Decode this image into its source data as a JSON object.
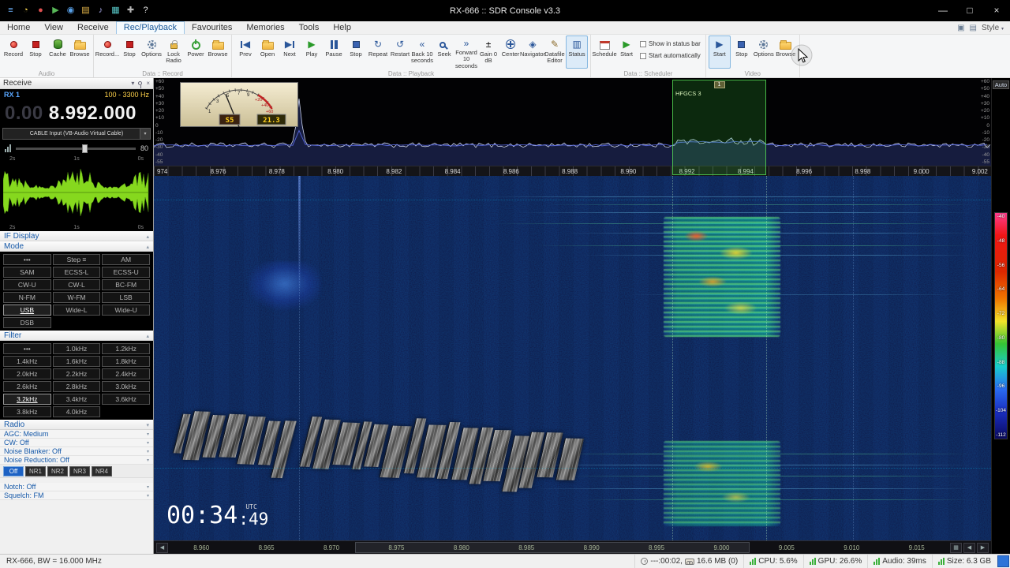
{
  "window": {
    "title": "RX-666 :: SDR Console v3.3",
    "minimize": "—",
    "maximize": "□",
    "close": "×",
    "quick_access": [
      {
        "name": "app-menu-icon",
        "glyph": "≡",
        "color": "#6fb4ff"
      },
      {
        "name": "clock-icon",
        "glyph": "◔",
        "color": "#e8c84a"
      },
      {
        "name": "record-icon",
        "glyph": "●",
        "color": "#e05050"
      },
      {
        "name": "play-icon",
        "glyph": "▶",
        "color": "#58b858"
      },
      {
        "name": "globe-icon",
        "glyph": "◉",
        "color": "#58a0e8"
      },
      {
        "name": "folder-icon",
        "glyph": "▤",
        "color": "#e8b84a"
      },
      {
        "name": "audio-icon",
        "glyph": "♪",
        "color": "#a8a8e8"
      },
      {
        "name": "grid-icon",
        "glyph": "▦",
        "color": "#58c8c8"
      },
      {
        "name": "tools-icon",
        "glyph": "✚",
        "color": "#b8b8b8"
      },
      {
        "name": "help-icon",
        "glyph": "?",
        "color": "#e8e8e8"
      }
    ]
  },
  "menubar": {
    "items": [
      {
        "label": "Home"
      },
      {
        "label": "View"
      },
      {
        "label": "Receive"
      },
      {
        "label": "Rec/Playback",
        "selected": true
      },
      {
        "label": "Favourites"
      },
      {
        "label": "Memories"
      },
      {
        "label": "Tools"
      },
      {
        "label": "Help"
      }
    ],
    "style_label": "Style"
  },
  "icons": {
    "chev_down": "▾",
    "chev_up": "▴",
    "prev": "◀",
    "next": "▶",
    "play": "▶",
    "repeat": "↻",
    "restart": "↺",
    "back10": "«",
    "fwd10": "»",
    "gain": "±",
    "navigator": "◈",
    "pencil": "✎",
    "status": "▥",
    "close": "×"
  },
  "ribbon": {
    "audio": {
      "title": "Audio",
      "record": "Record",
      "stop": "Stop",
      "cache": "Cache",
      "browse": "Browse"
    },
    "data_record": {
      "title": "Data :: Record",
      "record": "Record...",
      "stop": "Stop",
      "options": "Options",
      "lock": "Lock\nRadio",
      "power": "Power",
      "browse": "Browse"
    },
    "data_playback": {
      "title": "Data :: Playback",
      "prev": "Prev",
      "open": "Open",
      "next": "Next",
      "play": "Play",
      "pause": "Pause",
      "stop": "Stop",
      "repeat": "Repeat",
      "restart": "Restart",
      "back10": "Back 10\nseconds",
      "seek": "Seek",
      "fwd10": "Forward 10\nseconds",
      "gain": "Gain 0\ndB",
      "center": "Center",
      "navigator": "Navigator",
      "datafile": "Datafile\nEditor",
      "status": "Status"
    },
    "data_scheduler": {
      "title": "Data :: Scheduler",
      "schedule": "Schedule",
      "start": "Start",
      "checkbox_status": "Show in status bar",
      "checkbox_auto": "Start automatically"
    },
    "video": {
      "title": "Video",
      "start": "Start",
      "stop": "Stop",
      "options": "Options",
      "browse": "Browse"
    }
  },
  "receive": {
    "panel_title": "Receive",
    "rx_label": "RX 1",
    "range": "100 - 3300 Hz",
    "freq_dim": "0.00",
    "freq_main": "8.992.000",
    "audio_device": "CABLE Input (VB-Audio Virtual Cable)",
    "volume": "80",
    "wave_times": [
      "2s",
      "1s",
      "0s"
    ],
    "if_display_header": "IF Display",
    "mode_header": "Mode",
    "modes": [
      {
        "label": "•••"
      },
      {
        "label": "Step ≡"
      },
      {
        "label": "AM"
      },
      {
        "label": "SAM"
      },
      {
        "label": "ECSS-L"
      },
      {
        "label": "ECSS-U"
      },
      {
        "label": "CW-U"
      },
      {
        "label": "CW-L"
      },
      {
        "label": "BC-FM"
      },
      {
        "label": "N-FM"
      },
      {
        "label": "W-FM"
      },
      {
        "label": "LSB"
      },
      {
        "label": "USB",
        "selected": true
      },
      {
        "label": "Wide-L"
      },
      {
        "label": "Wide-U"
      },
      {
        "label": "DSB"
      }
    ],
    "filter_header": "Filter",
    "filters": [
      {
        "label": "•••"
      },
      {
        "label": "1.0kHz"
      },
      {
        "label": "1.2kHz"
      },
      {
        "label": "1.4kHz"
      },
      {
        "label": "1.6kHz"
      },
      {
        "label": "1.8kHz"
      },
      {
        "label": "2.0kHz"
      },
      {
        "label": "2.2kHz"
      },
      {
        "label": "2.4kHz"
      },
      {
        "label": "2.6kHz"
      },
      {
        "label": "2.8kHz"
      },
      {
        "label": "3.0kHz"
      },
      {
        "label": "3.2kHz",
        "selected": true
      },
      {
        "label": "3.4kHz"
      },
      {
        "label": "3.6kHz"
      },
      {
        "label": "3.8kHz"
      },
      {
        "label": "4.0kHz"
      }
    ],
    "radio_header": "Radio",
    "agc": "AGC: Medium",
    "cw": "CW: Off",
    "noise_blanker": "Noise Blanker: Off",
    "noise_reduction": "Noise Reduction: Off",
    "nr_buttons": [
      {
        "label": "Off",
        "selected": true
      },
      {
        "label": "NR1"
      },
      {
        "label": "NR2"
      },
      {
        "label": "NR3"
      },
      {
        "label": "NR4"
      }
    ],
    "notch": "Notch: Off",
    "squelch": "Squelch: FM"
  },
  "smeter": {
    "scale": [
      "1",
      "3",
      "5",
      "7",
      "9",
      "+20",
      "+40",
      "+60"
    ],
    "s_value": "S5",
    "db_value": "21.3"
  },
  "spectrum": {
    "db_labels": [
      "+60",
      "+50",
      "+40",
      "+30",
      "+20",
      "+10",
      "0",
      "-10",
      "-20",
      "-30",
      "-40",
      "-55"
    ],
    "selection": {
      "label": "HFGCS 3",
      "badge": "1"
    },
    "scale_labels": [
      "974",
      "8.976",
      "8.978",
      "8.980",
      "8.982",
      "8.984",
      "8.986",
      "8.988",
      "8.990",
      "8.992",
      "8.994",
      "8.996",
      "8.998",
      "9.000",
      "9.002"
    ]
  },
  "waterfall": {
    "clock_hm": "00:34",
    "clock_s": ":49",
    "clock_tz": "UTC"
  },
  "bottom_scale": {
    "labels": [
      "8.960",
      "8.965",
      "8.970",
      "8.975",
      "8.980",
      "8.985",
      "8.990",
      "8.995",
      "9.000",
      "9.005",
      "9.010",
      "9.015"
    ],
    "pan_left": "◀",
    "pan_right": "▶",
    "grid": "▦"
  },
  "colorbar": {
    "auto_label": "Auto",
    "labels": [
      "-40",
      "-48",
      "-56",
      "-64",
      "-72",
      "-80",
      "-88",
      "-96",
      "-104",
      "-112"
    ]
  },
  "statusbar": {
    "radio_info": "RX-666, BW = 16.000 MHz",
    "time": "---:00:02,",
    "buffer": "16.6 MB (0)",
    "cpu": "CPU: 5.6%",
    "gpu": "GPU: 26.6%",
    "audio": "Audio: 39ms",
    "size": "Size: 6.3 GB"
  }
}
